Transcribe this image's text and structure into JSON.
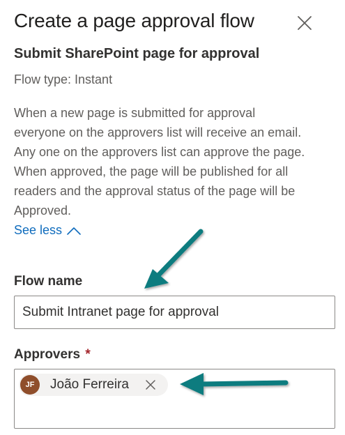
{
  "panel": {
    "title": "Create a page approval flow",
    "close_icon": "close-icon"
  },
  "flow": {
    "subtitle": "Submit SharePoint page for approval",
    "flow_type": "Flow type: Instant",
    "description": "When a new page is submitted for approval everyone on the approvers list will receive an email. Any one on the approvers list can approve the page. When approved, the page will be published for all readers and the approval status of the page will be Approved.",
    "see_less_label": "See less",
    "see_less_icon": "chevron-up-icon"
  },
  "form": {
    "flow_name_label": "Flow name",
    "flow_name_value": "Submit Intranet page for approval",
    "approvers_label": "Approvers",
    "required_marker": "*",
    "approvers": [
      {
        "initials": "JF",
        "name": "João Ferreira",
        "avatar_color": "#8f4e2b",
        "remove_icon": "close-icon"
      }
    ]
  },
  "annotations": {
    "arrow_color": "#0f7b7f",
    "arrow_icon": "annotation-arrow"
  },
  "colors": {
    "link": "#0f6cbd",
    "required": "#a4262c",
    "muted_text": "#605e5c"
  }
}
